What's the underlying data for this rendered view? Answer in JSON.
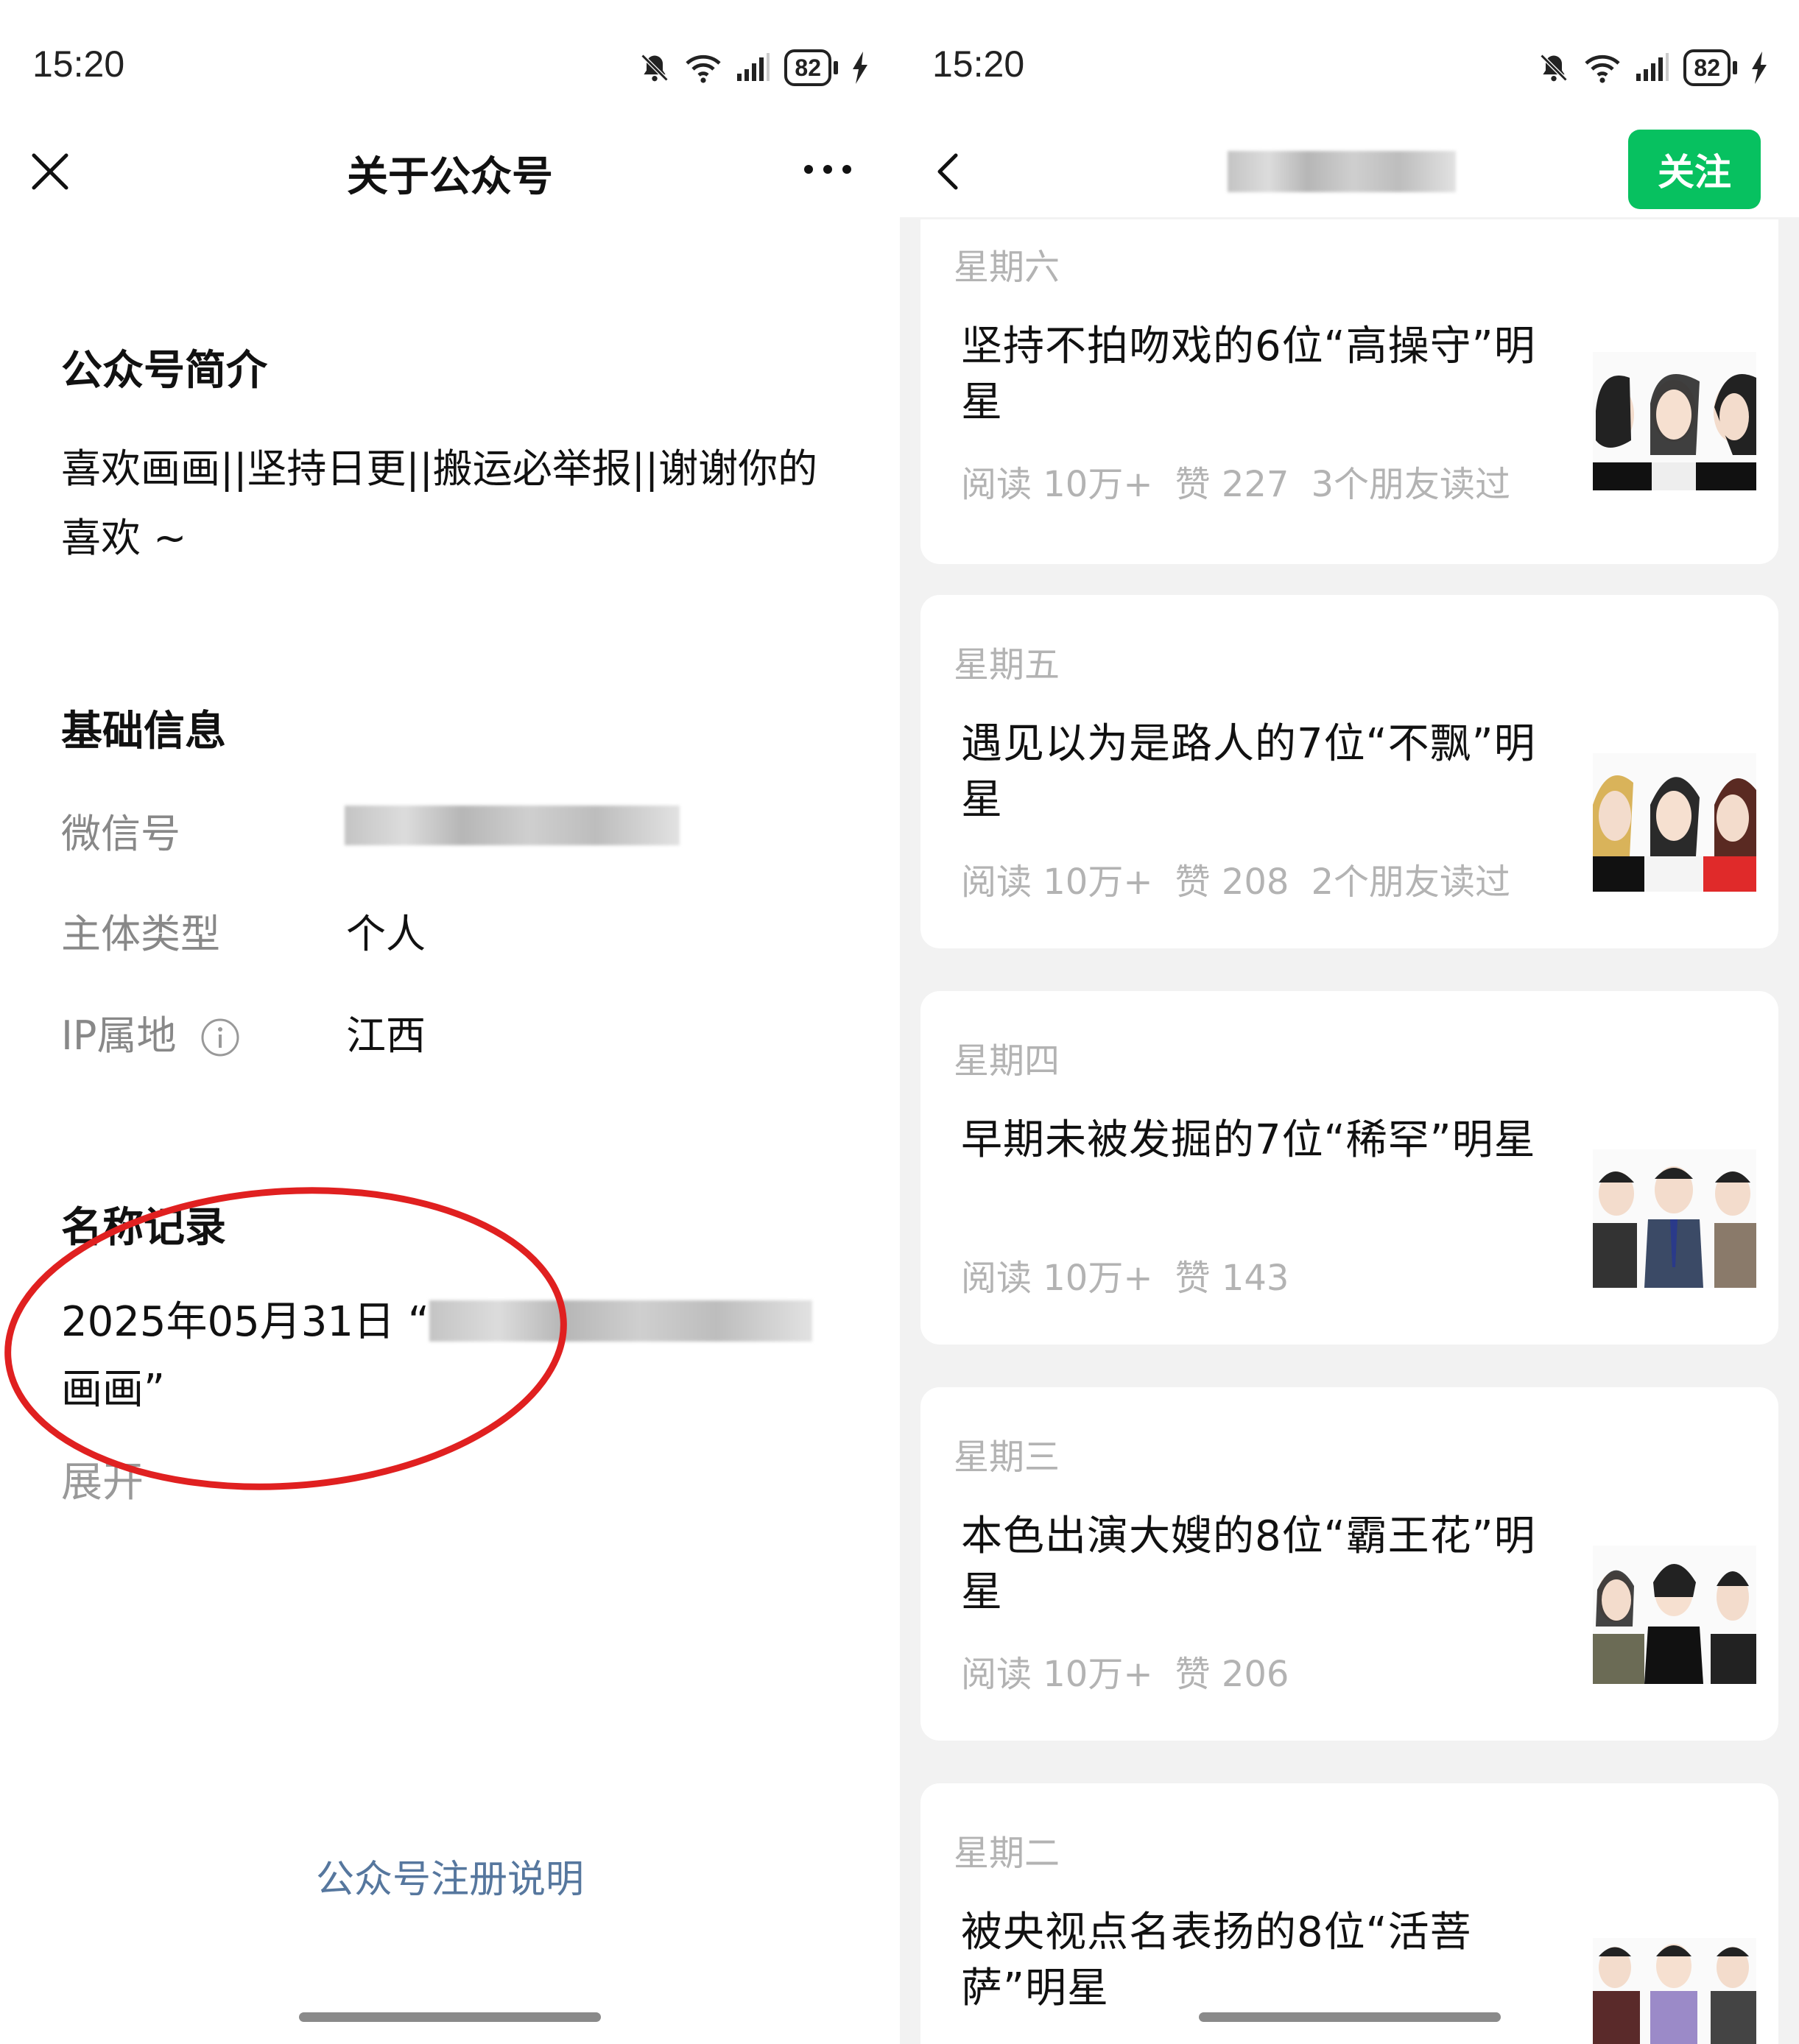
{
  "left": {
    "status": {
      "time": "15:20",
      "battery": "82"
    },
    "nav": {
      "title": "关于公众号"
    },
    "intro": {
      "title": "公众号简介",
      "text": "喜欢画画||坚持日更||搬运必举报||谢谢你的喜欢 ~"
    },
    "basic": {
      "title": "基础信息",
      "wechat_label": "微信号",
      "type_label": "主体类型",
      "type_value": "个人",
      "ip_label": "IP属地",
      "ip_value": "江西"
    },
    "names": {
      "title": "名称记录",
      "record_prefix": "2025年05月31日 “",
      "record_suffix": "画画”",
      "expand": "展开"
    },
    "register_link": "公众号注册说明"
  },
  "right": {
    "status": {
      "time": "15:20",
      "battery": "82"
    },
    "follow_label": "关注",
    "articles": [
      {
        "day": "星期六",
        "title": "坚持不拍吻戏的6位“高操守”明星",
        "reads": "阅读 10万+",
        "likes": "赞 227",
        "friends": "3个朋友读过"
      },
      {
        "day": "星期五",
        "title": "遇见以为是路人的7位“不飘”明星",
        "reads": "阅读 10万+",
        "likes": "赞 208",
        "friends": "2个朋友读过"
      },
      {
        "day": "星期四",
        "title": "早期未被发掘的7位“稀罕”明星",
        "reads": "阅读 10万+",
        "likes": "赞 143",
        "friends": ""
      },
      {
        "day": "星期三",
        "title": "本色出演大嫂的8位“霸王花”明星",
        "reads": "阅读 10万+",
        "likes": "赞 206",
        "friends": ""
      },
      {
        "day": "星期二",
        "title": "被央视点名表扬的8位“活菩萨”明星",
        "reads": "",
        "likes": "",
        "friends": ""
      }
    ]
  },
  "colors": {
    "accent_green": "#07c160",
    "link_blue": "#56779e",
    "annotation_red": "#e02020",
    "muted_gray": "#b3b3b3"
  },
  "icons": [
    "close-icon",
    "more-icon",
    "back-icon",
    "info-icon",
    "bell-off-icon",
    "wifi-icon",
    "signal-icon",
    "battery-icon",
    "charging-icon"
  ]
}
